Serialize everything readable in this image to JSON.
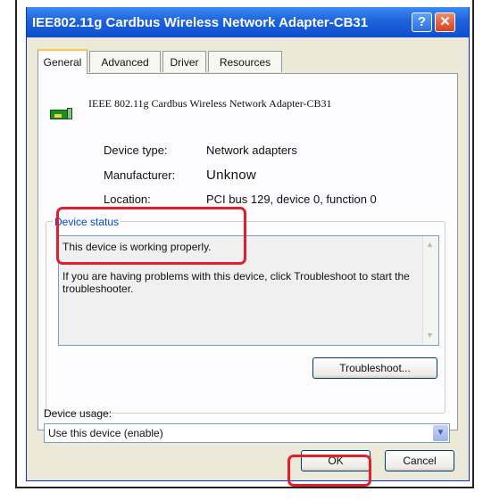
{
  "window": {
    "title": "IEE802.11g Cardbus Wireless Network Adapter-CB31",
    "help_label": "?",
    "close_label": "✕"
  },
  "tabs": [
    {
      "label": "General",
      "active": true
    },
    {
      "label": "Advanced",
      "active": false
    },
    {
      "label": "Driver",
      "active": false
    },
    {
      "label": "Resources",
      "active": false
    }
  ],
  "device": {
    "icon": "network-card-icon",
    "name": "IEEE 802.11g Cardbus Wireless Network Adapter-CB31"
  },
  "properties": [
    {
      "label": "Device type:",
      "value": "Network adapters"
    },
    {
      "label": "Manufacturer:",
      "value": "Unknow"
    },
    {
      "label": "Location:",
      "value": "PCI bus 129, device 0, function 0"
    }
  ],
  "status": {
    "group_label": "Device status",
    "line1": "This device is working properly.",
    "line2": "If you are having problems with this device, click Troubleshoot to start the troubleshooter."
  },
  "buttons": {
    "troubleshoot": "Troubleshoot...",
    "ok": "OK",
    "cancel": "Cancel"
  },
  "usage": {
    "label": "Device usage:",
    "selected": "Use this device (enable)"
  },
  "colors": {
    "highlight": "#e3202a",
    "titlebar": "#1f62da",
    "group_label": "#0046d5"
  }
}
